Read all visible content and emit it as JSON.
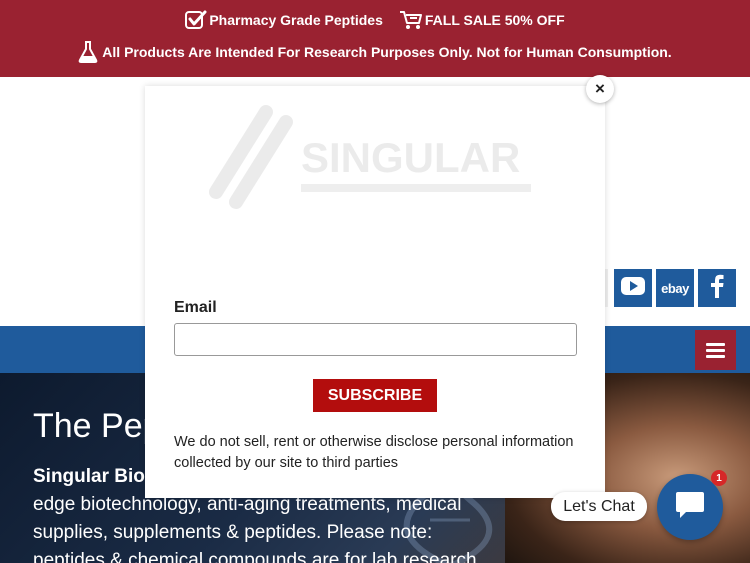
{
  "promo": {
    "item1": "Pharmacy Grade Peptides",
    "item1_icon": "checkbox-icon",
    "item2": "FALL SALE 50% OFF",
    "item2_icon": "cart-icon",
    "notice": "All Products Are Intended For Research Purposes Only. Not for Human Consumption.",
    "notice_icon": "flask-icon"
  },
  "header": {
    "logo_text": "SINGULAR",
    "social": [
      {
        "name": "youtube",
        "icon": "youtube-icon"
      },
      {
        "name": "ebay",
        "label": "ebay",
        "icon": "ebay-icon"
      },
      {
        "name": "facebook",
        "icon": "facebook-icon"
      }
    ]
  },
  "nav": {
    "menu_icon": "hamburger-menu-icon"
  },
  "hero": {
    "title": "The Pep",
    "subtitle": "Singular Biot",
    "line1": "edge biotechnology, anti-aging treatments, medical",
    "line2": "supplies, supplements & peptides. Please note:",
    "line3": "peptides & chemical compounds are for lab research"
  },
  "modal": {
    "close_label": "×",
    "email_label": "Email",
    "email_value": "",
    "email_placeholder": "",
    "subscribe_label": "SUBSCRIBE",
    "disclaimer": "We do not sell, rent or otherwise disclose personal information collected by our site to third parties"
  },
  "chat": {
    "label": "Let's Chat",
    "badge_count": "1",
    "icon": "chat-bubble-icon"
  },
  "colors": {
    "promo_bg": "#9a2231",
    "nav_bg": "#1f5b9c",
    "subscribe_bg": "#b30d0d",
    "chat_bg": "#1f5b9c"
  }
}
